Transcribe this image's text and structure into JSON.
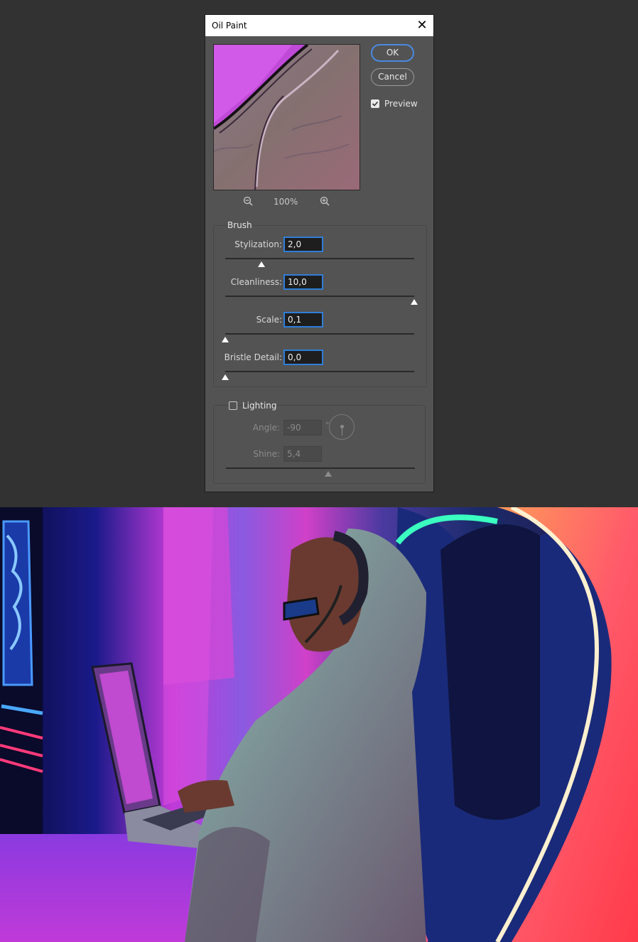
{
  "dialog": {
    "title": "Oil Paint",
    "ok_label": "OK",
    "cancel_label": "Cancel",
    "preview_label": "Preview",
    "preview_checked": true,
    "zoom_level": "100%"
  },
  "brush": {
    "title": "Brush",
    "params": [
      {
        "label": "Stylization:",
        "value": "2,0",
        "fraction": 0.19
      },
      {
        "label": "Cleanliness:",
        "value": "10,0",
        "fraction": 1.0
      },
      {
        "label": "Scale:",
        "value": "0,1",
        "fraction": 0.0
      },
      {
        "label": "Bristle Detail:",
        "value": "0,0",
        "fraction": 0.0
      }
    ]
  },
  "lighting": {
    "label": "Lighting",
    "checked": false,
    "angle_label": "Angle:",
    "angle_value": "-90",
    "angle_unit": "°",
    "shine_label": "Shine:",
    "shine_value": "5,4",
    "shine_fraction": 0.54
  },
  "colors": {
    "accent": "#2f7ed8",
    "dialog_bg": "#535353",
    "page_bg": "#323232"
  }
}
